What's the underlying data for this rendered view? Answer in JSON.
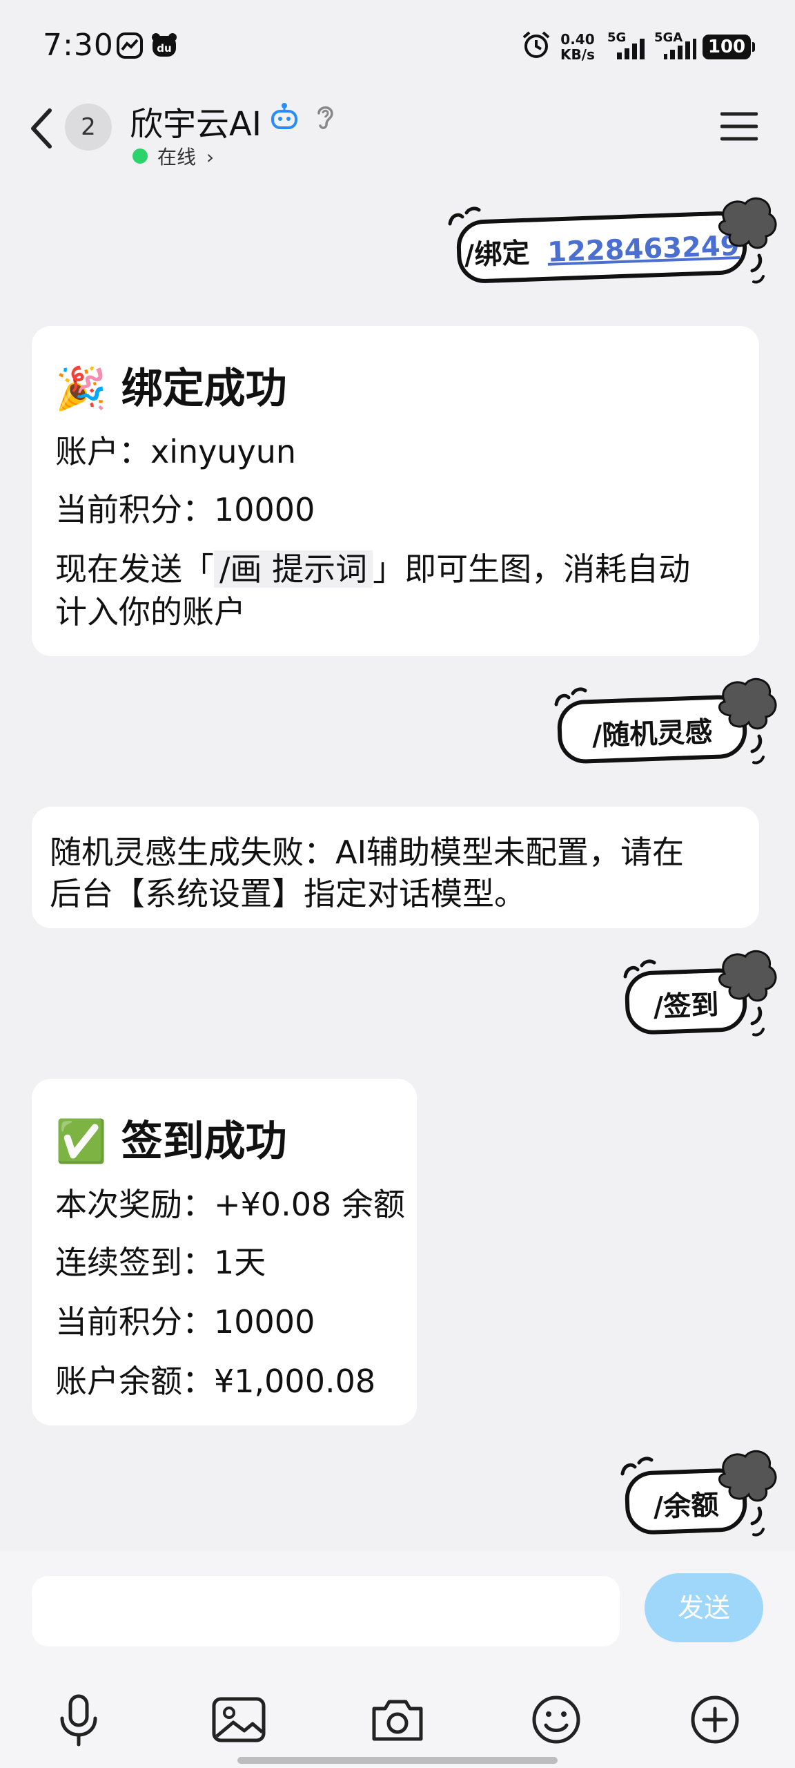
{
  "status_bar": {
    "time": "7:30",
    "net_speed_value": "0.40",
    "net_speed_unit": "KB/s",
    "sim1": "5G",
    "sim2": "5GA",
    "battery": "100"
  },
  "header": {
    "unread_count": "2",
    "title": "欣宇云AI",
    "status": "在线",
    "status_chevron": "›"
  },
  "messages": [
    {
      "type": "user",
      "command": "/绑定",
      "argument": "1228463249"
    },
    {
      "type": "bot",
      "emoji": "🎉",
      "heading": "绑定成功",
      "account_label": "账户：",
      "account_value": "xinyuyun",
      "points_label": "当前积分：",
      "points_value": "10000",
      "info_pre": "现在发送「",
      "info_code": "/画  提示词",
      "info_post": "」即可生图，消耗自动",
      "info_line2": "计入你的账户"
    },
    {
      "type": "user",
      "command": "/随机灵感"
    },
    {
      "type": "bot",
      "line1": "随机灵感生成失败：AI辅助模型未配置，请在",
      "line2": "后台【系统设置】指定对话模型。"
    },
    {
      "type": "user",
      "command": "/签到"
    },
    {
      "type": "bot",
      "emoji": "✅",
      "heading": "签到成功",
      "reward_label": "本次奖励：",
      "reward_value": "+¥0.08 余额",
      "streak_label": "连续签到：",
      "streak_value": "1天",
      "points_label": "当前积分：",
      "points_value": "10000",
      "balance_label": "账户余额：",
      "balance_value": "¥1,000.08"
    },
    {
      "type": "user",
      "command": "/余额"
    }
  ],
  "input": {
    "placeholder": "",
    "send_label": "发送"
  },
  "toolbar_icons": [
    "microphone-icon",
    "image-icon",
    "camera-icon",
    "emoji-icon",
    "plus-icon"
  ],
  "colors": {
    "background": "#f1f1f3",
    "online": "#2bd36a",
    "link": "#4a6fd0",
    "send_button": "#9fd7fb"
  }
}
